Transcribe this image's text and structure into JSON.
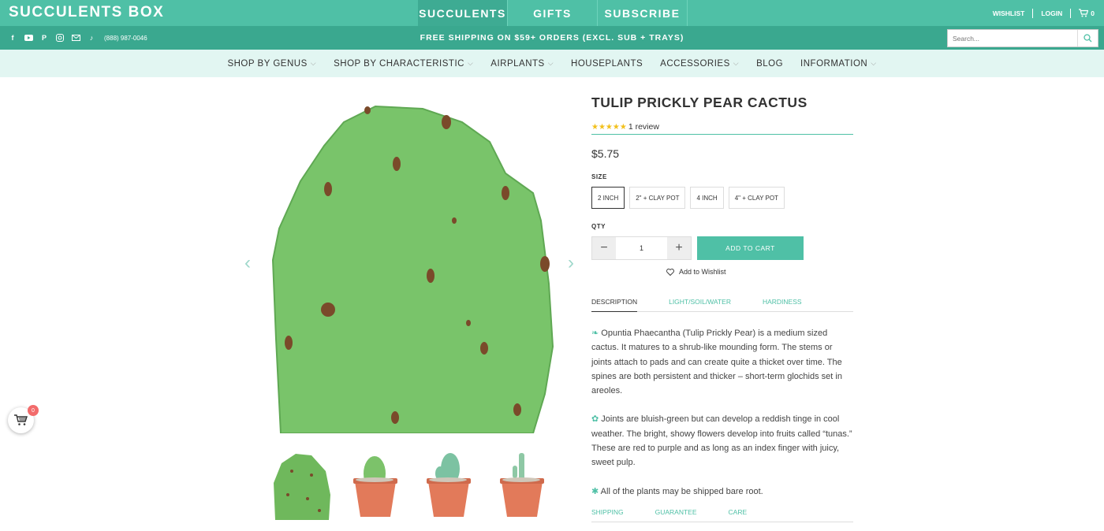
{
  "header": {
    "logo": "SUCCULENTS BOX",
    "top_nav": [
      {
        "label": "SUCCULENTS",
        "active": true
      },
      {
        "label": "GIFTS",
        "active": false
      },
      {
        "label": "SUBSCRIBE",
        "active": false
      }
    ],
    "account": {
      "wishlist": "WISHLIST",
      "login": "LOGIN",
      "cart_count": "0"
    },
    "phone": "(888) 987-0046",
    "shipping_banner": "FREE SHIPPING ON $59+ ORDERS (EXCL. SUB + TRAYS)",
    "search_placeholder": "Search...",
    "socials": [
      "facebook-icon",
      "youtube-icon",
      "pinterest-icon",
      "instagram-icon",
      "email-icon",
      "tiktok-icon"
    ]
  },
  "main_nav": [
    {
      "label": "SHOP BY GENUS",
      "dropdown": true
    },
    {
      "label": "SHOP BY CHARACTERISTIC",
      "dropdown": true
    },
    {
      "label": "AIRPLANTS",
      "dropdown": true
    },
    {
      "label": "HOUSEPLANTS",
      "dropdown": false
    },
    {
      "label": "ACCESSORIES",
      "dropdown": true
    },
    {
      "label": "BLOG",
      "dropdown": false
    },
    {
      "label": "INFORMATION",
      "dropdown": true
    }
  ],
  "product": {
    "title": "TULIP PRICKLY PEAR CACTUS",
    "stars": "★★★★★",
    "rating_value": 5,
    "reviews": "1 review",
    "price": "$5.75",
    "size_label": "SIZE",
    "sizes": [
      "2 INCH",
      "2\" + CLAY POT",
      "4 INCH",
      "4\" + CLAY POT"
    ],
    "selected_size": "2 INCH",
    "qty_label": "QTY",
    "qty": "1",
    "add_to_cart": "ADD TO CART",
    "wishlist": "Add to Wishlist",
    "tabs": [
      {
        "label": "DESCRIPTION",
        "active": true
      },
      {
        "label": "LIGHT/SOIL/WATER",
        "active": false
      },
      {
        "label": "HARDINESS",
        "active": false
      }
    ],
    "description": [
      "Opuntia Phaecantha (Tulip Prickly Pear) is a medium sized cactus. It matures to a shrub-like mounding form. The stems or joints attach to pads and can create quite a thicket over time. The spines are both persistent and thicker – short-term glochids set in areoles.",
      "Joints are bluish-green but can develop a reddish tinge in cool weather. The bright, showy flowers develop into fruits called “tunas.” These are red to purple and as long as an index finger with juicy, sweet pulp.",
      "All of the plants may be shipped bare root."
    ],
    "tabs2": [
      {
        "label": "SHIPPING"
      },
      {
        "label": "GUARANTEE"
      },
      {
        "label": "CARE"
      }
    ]
  },
  "floating_cart": {
    "count": "0"
  },
  "colors": {
    "brand": "#4fc0a6",
    "brand_dark": "#3aa88f",
    "nav_bg": "#e2f6f2",
    "star": "#f2c01b",
    "badge": "#f26b6b"
  }
}
